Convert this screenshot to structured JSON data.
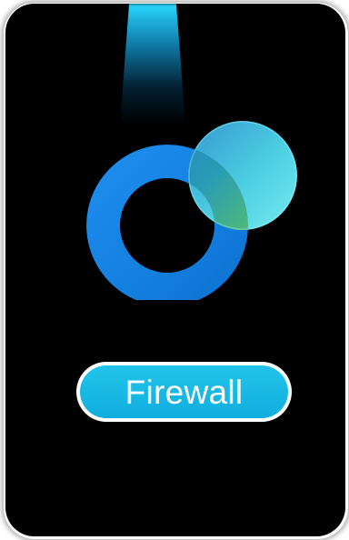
{
  "app": {
    "label": "Firewall",
    "icon": "firewall-rings-icon"
  },
  "colors": {
    "card_background": "#000000",
    "ring_blue": "#1787e6",
    "bubble_cyan": "#5ef0ff",
    "bubble_green": "#6fcf3a",
    "label_fill": "#15b6e3",
    "label_border": "#ffffff",
    "label_text": "#ffffff"
  }
}
